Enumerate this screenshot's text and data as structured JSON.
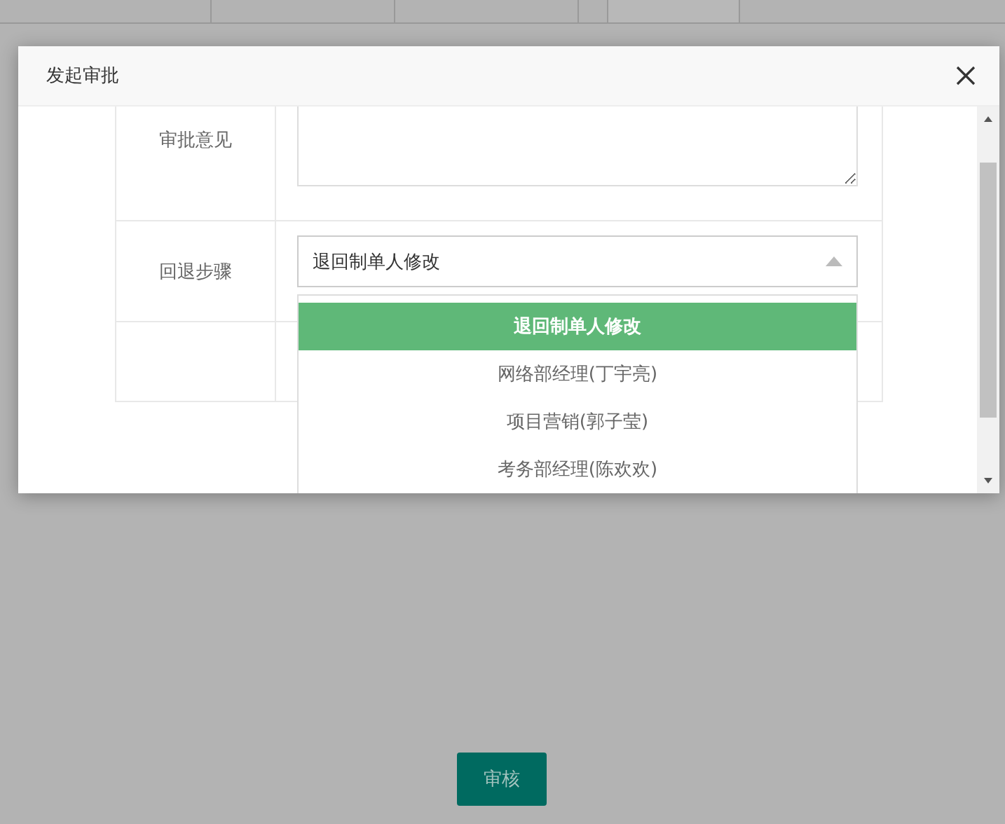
{
  "dialog": {
    "title": "发起审批"
  },
  "form": {
    "rows": [
      {
        "kind": "textarea",
        "label": "审批意见"
      },
      {
        "kind": "select",
        "label": "回退步骤",
        "value": "退回制单人修改",
        "expanded": true,
        "options": [
          {
            "label": "退回制单人修改",
            "selected": true
          },
          {
            "label": "网络部经理(丁宇亮)",
            "selected": false
          },
          {
            "label": "项目营销(郭子莹)",
            "selected": false
          },
          {
            "label": "考务部经理(陈欢欢)",
            "selected": false
          }
        ]
      },
      {
        "kind": "empty"
      }
    ]
  },
  "submit_button": "审核"
}
